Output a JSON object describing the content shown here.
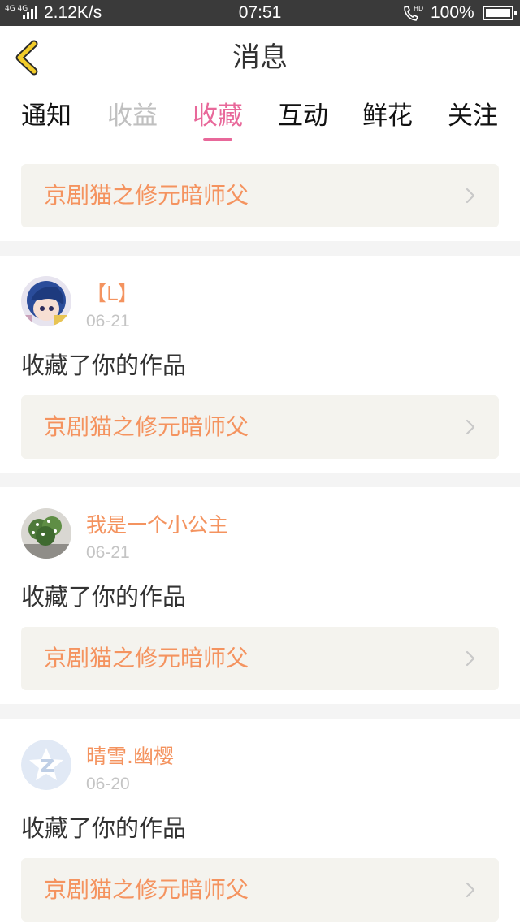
{
  "status_bar": {
    "network_type": "4G 4G",
    "speed": "2.12K/s",
    "time": "07:51",
    "call_badge": "HD",
    "battery": "100%"
  },
  "header": {
    "title": "消息",
    "back_icon": "chevron-left-icon",
    "accent_color": "#f2cc2a"
  },
  "tabs": [
    {
      "label": "通知",
      "state": "normal"
    },
    {
      "label": "收益",
      "state": "disabled"
    },
    {
      "label": "收藏",
      "state": "active"
    },
    {
      "label": "互动",
      "state": "normal"
    },
    {
      "label": "鲜花",
      "state": "normal"
    },
    {
      "label": "关注",
      "state": "normal"
    }
  ],
  "active_color": "#e8689a",
  "top_work": {
    "title": "京剧猫之修元暗师父"
  },
  "notifications": [
    {
      "name": "【L】",
      "date": "06-21",
      "action": "收藏了你的作品",
      "work": "京剧猫之修元暗师父",
      "avatar": "anime-avatar"
    },
    {
      "name": "我是一个小公主",
      "date": "06-21",
      "action": "收藏了你的作品",
      "work": "京剧猫之修元暗师父",
      "avatar": "plant-avatar"
    },
    {
      "name": "晴雪.幽樱",
      "date": "06-20",
      "action": "收藏了你的作品",
      "work": "京剧猫之修元暗师父",
      "avatar": "qq-default-avatar"
    }
  ]
}
